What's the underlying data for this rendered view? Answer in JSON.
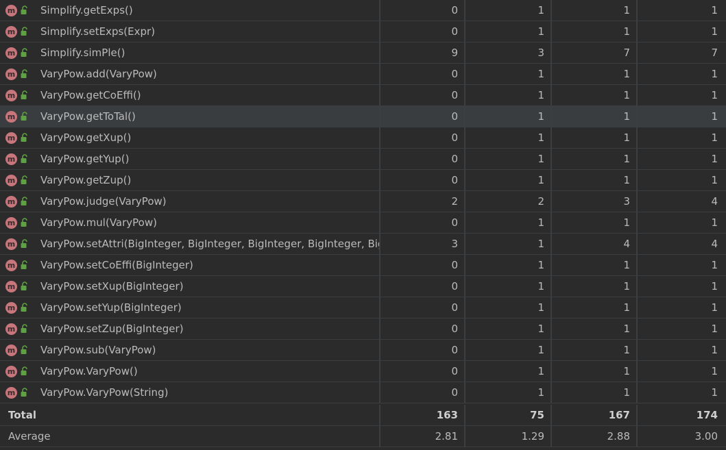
{
  "methods": [
    {
      "name": "Simplify.getExps()",
      "v": [
        "0",
        "1",
        "1",
        "1"
      ]
    },
    {
      "name": "Simplify.setExps(Expr)",
      "v": [
        "0",
        "1",
        "1",
        "1"
      ]
    },
    {
      "name": "Simplify.simPle()",
      "v": [
        "9",
        "3",
        "7",
        "7"
      ]
    },
    {
      "name": "VaryPow.add(VaryPow)",
      "v": [
        "0",
        "1",
        "1",
        "1"
      ]
    },
    {
      "name": "VaryPow.getCoEffi()",
      "v": [
        "0",
        "1",
        "1",
        "1"
      ]
    },
    {
      "name": "VaryPow.getToTal()",
      "v": [
        "0",
        "1",
        "1",
        "1"
      ]
    },
    {
      "name": "VaryPow.getXup()",
      "v": [
        "0",
        "1",
        "1",
        "1"
      ]
    },
    {
      "name": "VaryPow.getYup()",
      "v": [
        "0",
        "1",
        "1",
        "1"
      ]
    },
    {
      "name": "VaryPow.getZup()",
      "v": [
        "0",
        "1",
        "1",
        "1"
      ]
    },
    {
      "name": "VaryPow.judge(VaryPow)",
      "v": [
        "2",
        "2",
        "3",
        "4"
      ]
    },
    {
      "name": "VaryPow.mul(VaryPow)",
      "v": [
        "0",
        "1",
        "1",
        "1"
      ]
    },
    {
      "name": "VaryPow.setAttri(BigInteger, BigInteger, BigInteger, BigInteger, BigIn",
      "v": [
        "3",
        "1",
        "4",
        "4"
      ]
    },
    {
      "name": "VaryPow.setCoEffi(BigInteger)",
      "v": [
        "0",
        "1",
        "1",
        "1"
      ]
    },
    {
      "name": "VaryPow.setXup(BigInteger)",
      "v": [
        "0",
        "1",
        "1",
        "1"
      ]
    },
    {
      "name": "VaryPow.setYup(BigInteger)",
      "v": [
        "0",
        "1",
        "1",
        "1"
      ]
    },
    {
      "name": "VaryPow.setZup(BigInteger)",
      "v": [
        "0",
        "1",
        "1",
        "1"
      ]
    },
    {
      "name": "VaryPow.sub(VaryPow)",
      "v": [
        "0",
        "1",
        "1",
        "1"
      ]
    },
    {
      "name": "VaryPow.VaryPow()",
      "v": [
        "0",
        "1",
        "1",
        "1"
      ]
    },
    {
      "name": "VaryPow.VaryPow(String)",
      "v": [
        "0",
        "1",
        "1",
        "1"
      ]
    }
  ],
  "selected_index": 5,
  "method_icon": {
    "glyph": "m",
    "icon": "method-icon",
    "color": "#c7767c"
  },
  "access_icon": {
    "icon": "public-unlocked-icon",
    "color": "#5ea143"
  },
  "total": {
    "label": "Total",
    "v": [
      "163",
      "75",
      "167",
      "174"
    ]
  },
  "average": {
    "label": "Average",
    "v": [
      "2.81",
      "1.29",
      "2.88",
      "3.00"
    ]
  }
}
